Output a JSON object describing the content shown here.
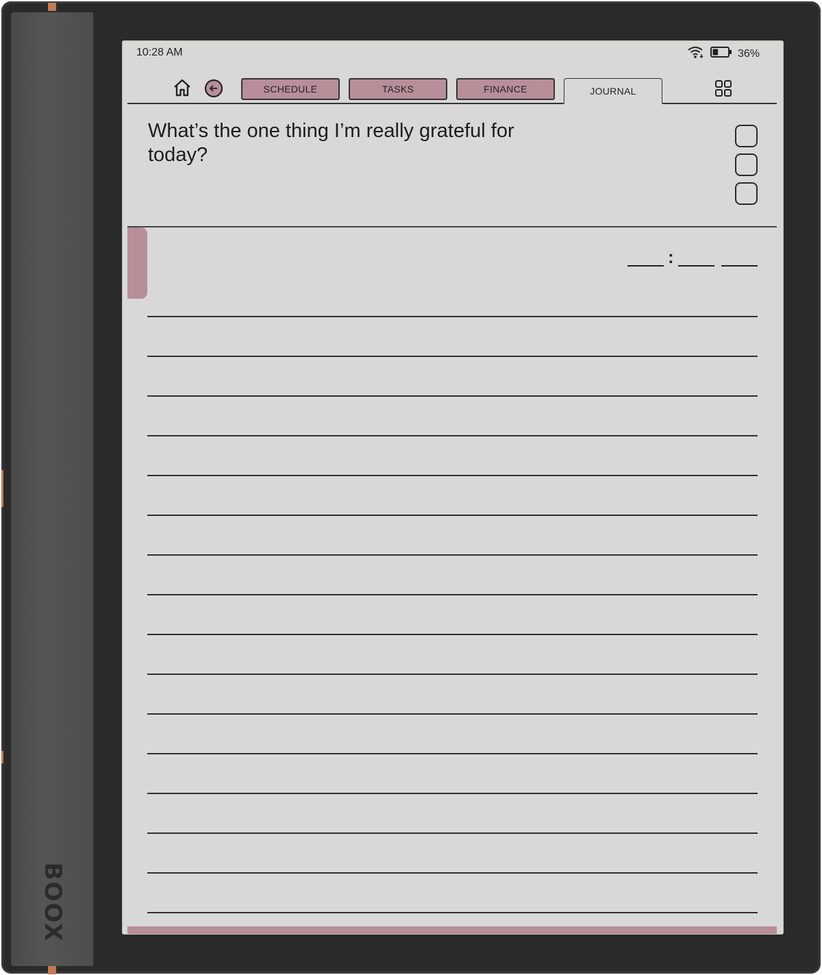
{
  "device": {
    "brand": "BOOX"
  },
  "status_bar": {
    "time": "10:28 AM",
    "battery_percent": "36%",
    "battery_level": 0.36
  },
  "tabs": [
    {
      "label": "SCHEDULE",
      "active": false
    },
    {
      "label": "TASKS",
      "active": false
    },
    {
      "label": "FINANCE",
      "active": false
    },
    {
      "label": "JOURNAL",
      "active": true
    }
  ],
  "journal": {
    "prompt": "What’s the one thing I’m really grateful for today?",
    "time_separator": ":",
    "checkbox_count": 3,
    "ruled_line_count": 16
  },
  "colors": {
    "accent_pink": "#b88e98",
    "screen_bg": "#d8d9d7",
    "bezel": "#2a2a2a"
  },
  "icons": [
    "home-icon",
    "back-arrow-icon",
    "grid-icon",
    "wifi-icon",
    "battery-icon"
  ]
}
